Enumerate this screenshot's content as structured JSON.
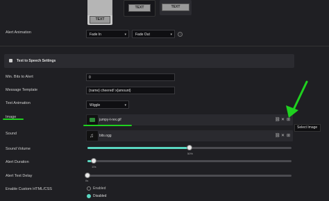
{
  "animation_thumbs": [
    {
      "label": "TEXT"
    },
    {
      "label": "TEXT"
    },
    {
      "label": "TEXT"
    }
  ],
  "alert_animation": {
    "label": "Alert Animation",
    "in_value": "Fade In",
    "out_value": "Fade Out"
  },
  "tts_section": {
    "label": "Text to Speech Settings"
  },
  "min_bits": {
    "label": "Min. Bits to Alert",
    "value": "0"
  },
  "message_template": {
    "label": "Message Template",
    "value": "{name} cheered! x{amount}"
  },
  "text_animation": {
    "label": "Text Animation",
    "value": "Wiggle"
  },
  "image": {
    "label": "Image",
    "filename": "jumpy-t-rex.gif"
  },
  "sound": {
    "label": "Sound",
    "filename": "bits.ogg"
  },
  "tooltip": {
    "text": "Select Image"
  },
  "sound_volume": {
    "label": "Sound Volume",
    "value": 50,
    "display": "50%"
  },
  "alert_duration": {
    "label": "Alert Duration",
    "value": 0.03,
    "display": "10s"
  },
  "alert_text_delay": {
    "label": "Alert Text Delay",
    "value": 0,
    "display": "0s"
  },
  "custom_html": {
    "label": "Enable Custom HTML/CSS",
    "options": [
      "Enabled",
      "Disabled"
    ],
    "selected": "Disabled"
  },
  "colors": {
    "accent": "#5ad8c2",
    "annotation": "#1fd11f",
    "panel": "#1f1f23"
  }
}
